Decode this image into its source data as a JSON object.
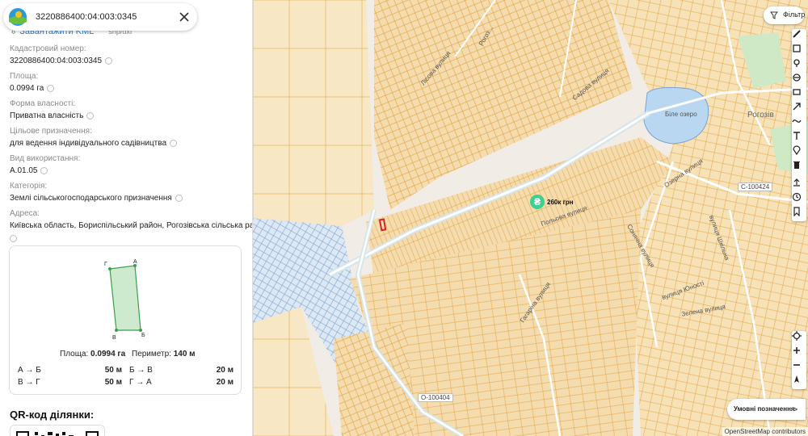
{
  "search": {
    "value": "3220886400:04:003:0345"
  },
  "actions": {
    "download_kml": "Завантажити KML",
    "extra": "shp/dxf"
  },
  "parcel": {
    "cadastral": {
      "label": "Кадастровий номер:",
      "value": "3220886400:04:003:0345"
    },
    "area": {
      "label": "Площа:",
      "value": "0.0994 га"
    },
    "ownership": {
      "label": "Форма власності:",
      "value": "Приватна власність"
    },
    "purpose": {
      "label": "Цільове призначення:",
      "value": "для ведення індивідуального садівництва"
    },
    "use_type": {
      "label": "Вид використання:",
      "value": "А.01.05"
    },
    "category": {
      "label": "Категорія:",
      "value": "Землі сільськогосподарського призначення"
    },
    "address": {
      "label": "Адреса:",
      "value": "Київська область, Бориспільський район, Рогозівська сільська рада"
    }
  },
  "shape_card": {
    "vertices": [
      "Г",
      "А",
      "В",
      "Б"
    ],
    "area_label": "Площа:",
    "area_value": "0.0994 га",
    "perimeter_label": "Периметр:",
    "perimeter_value": "140 м",
    "segments": [
      {
        "label": "А → Б",
        "value": "50 м"
      },
      {
        "label": "Б → В",
        "value": "20 м"
      },
      {
        "label": "В → Г",
        "value": "50 м"
      },
      {
        "label": "Г → А",
        "value": "20 м"
      }
    ]
  },
  "qr": {
    "title": "QR-код ділянки:"
  },
  "map": {
    "labels": {
      "lake": "Біле озеро",
      "town": "Рогозів",
      "street_ozerna": "Озерна вулиця",
      "street_polova": "Польова вулиця",
      "street_sadova": "Садова вулиця",
      "street_gagarina": "Гагаріна вулиця",
      "street_sho": "вулиця Шкільна",
      "street_yunosti": "вулиця Юності",
      "street_zelena": "Зелена вулиця",
      "street_lisova": "Лісова вулиця",
      "street_sonyachna": "Сонячна вулиця",
      "road_c100424": "С-100424",
      "road_o100404": "О-100404",
      "road_rogoz": "Рогоз..."
    },
    "price": {
      "symbol": "₴",
      "value": "260к грн"
    },
    "filter_label": "Фільтр",
    "legend_label": "Умовні позначення",
    "attribution": "OpenStreetMap contributors",
    "colors": {
      "parcel_fill": "#f5dcae",
      "parcel_stroke": "#e0a13d",
      "water": "#b9d7f0",
      "road": "#cfe1e6",
      "selected": "#d8232a"
    }
  }
}
